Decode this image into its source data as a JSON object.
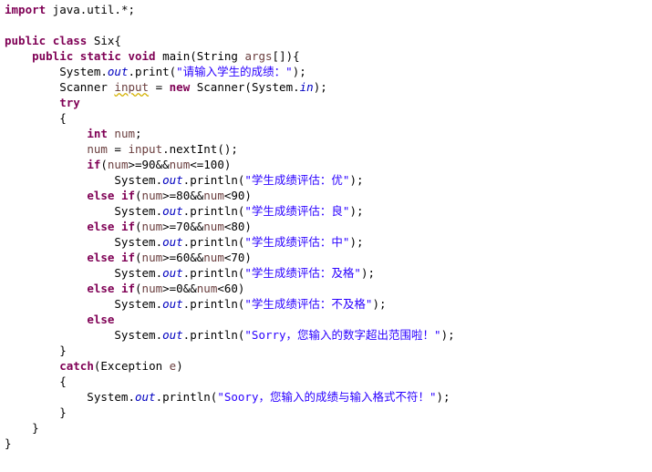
{
  "lines": [
    [
      {
        "t": "import",
        "c": "kw"
      },
      {
        "t": " java.util.*;"
      }
    ],
    [],
    [
      {
        "t": "public",
        "c": "kw"
      },
      {
        "t": " "
      },
      {
        "t": "class",
        "c": "kw"
      },
      {
        "t": " Six{"
      }
    ],
    [
      {
        "t": "    "
      },
      {
        "t": "public",
        "c": "kw"
      },
      {
        "t": " "
      },
      {
        "t": "static",
        "c": "kw"
      },
      {
        "t": " "
      },
      {
        "t": "void",
        "c": "kw"
      },
      {
        "t": " main(String "
      },
      {
        "t": "args",
        "c": "lv"
      },
      {
        "t": "[]){"
      }
    ],
    [
      {
        "t": "        System."
      },
      {
        "t": "out",
        "c": "fld"
      },
      {
        "t": ".print("
      },
      {
        "t": "\"请输入学生的成绩：\"",
        "c": "str"
      },
      {
        "t": ");"
      }
    ],
    [
      {
        "t": "        Scanner "
      },
      {
        "t": "input",
        "c": "lv warn"
      },
      {
        "t": " = "
      },
      {
        "t": "new",
        "c": "kw"
      },
      {
        "t": " Scanner(System."
      },
      {
        "t": "in",
        "c": "fld"
      },
      {
        "t": ");"
      }
    ],
    [
      {
        "t": "        "
      },
      {
        "t": "try",
        "c": "kw"
      }
    ],
    [
      {
        "t": "        {"
      }
    ],
    [
      {
        "t": "            "
      },
      {
        "t": "int",
        "c": "kw"
      },
      {
        "t": " "
      },
      {
        "t": "num",
        "c": "lv"
      },
      {
        "t": ";"
      }
    ],
    [
      {
        "t": "            "
      },
      {
        "t": "num",
        "c": "lv"
      },
      {
        "t": " = "
      },
      {
        "t": "input",
        "c": "lv"
      },
      {
        "t": ".nextInt();"
      }
    ],
    [
      {
        "t": "            "
      },
      {
        "t": "if",
        "c": "kw"
      },
      {
        "t": "("
      },
      {
        "t": "num",
        "c": "lv"
      },
      {
        "t": ">=90&&"
      },
      {
        "t": "num",
        "c": "lv"
      },
      {
        "t": "<=100)"
      }
    ],
    [
      {
        "t": "                System."
      },
      {
        "t": "out",
        "c": "fld"
      },
      {
        "t": ".println("
      },
      {
        "t": "\"学生成绩评估：优\"",
        "c": "str"
      },
      {
        "t": ");"
      }
    ],
    [
      {
        "t": "            "
      },
      {
        "t": "else",
        "c": "kw"
      },
      {
        "t": " "
      },
      {
        "t": "if",
        "c": "kw"
      },
      {
        "t": "("
      },
      {
        "t": "num",
        "c": "lv"
      },
      {
        "t": ">=80&&"
      },
      {
        "t": "num",
        "c": "lv"
      },
      {
        "t": "<90)"
      }
    ],
    [
      {
        "t": "                System."
      },
      {
        "t": "out",
        "c": "fld"
      },
      {
        "t": ".println("
      },
      {
        "t": "\"学生成绩评估：良\"",
        "c": "str"
      },
      {
        "t": ");"
      }
    ],
    [
      {
        "t": "            "
      },
      {
        "t": "else",
        "c": "kw"
      },
      {
        "t": " "
      },
      {
        "t": "if",
        "c": "kw"
      },
      {
        "t": "("
      },
      {
        "t": "num",
        "c": "lv"
      },
      {
        "t": ">=70&&"
      },
      {
        "t": "num",
        "c": "lv"
      },
      {
        "t": "<80)"
      }
    ],
    [
      {
        "t": "                System."
      },
      {
        "t": "out",
        "c": "fld"
      },
      {
        "t": ".println("
      },
      {
        "t": "\"学生成绩评估：中\"",
        "c": "str"
      },
      {
        "t": ");"
      }
    ],
    [
      {
        "t": "            "
      },
      {
        "t": "else",
        "c": "kw"
      },
      {
        "t": " "
      },
      {
        "t": "if",
        "c": "kw"
      },
      {
        "t": "("
      },
      {
        "t": "num",
        "c": "lv"
      },
      {
        "t": ">=60&&"
      },
      {
        "t": "num",
        "c": "lv"
      },
      {
        "t": "<70)"
      }
    ],
    [
      {
        "t": "                System."
      },
      {
        "t": "out",
        "c": "fld"
      },
      {
        "t": ".println("
      },
      {
        "t": "\"学生成绩评估：及格\"",
        "c": "str"
      },
      {
        "t": ");"
      }
    ],
    [
      {
        "t": "            "
      },
      {
        "t": "else",
        "c": "kw"
      },
      {
        "t": " "
      },
      {
        "t": "if",
        "c": "kw"
      },
      {
        "t": "("
      },
      {
        "t": "num",
        "c": "lv"
      },
      {
        "t": ">=0&&"
      },
      {
        "t": "num",
        "c": "lv"
      },
      {
        "t": "<60)"
      }
    ],
    [
      {
        "t": "                System."
      },
      {
        "t": "out",
        "c": "fld"
      },
      {
        "t": ".println("
      },
      {
        "t": "\"学生成绩评估：不及格\"",
        "c": "str"
      },
      {
        "t": ");"
      }
    ],
    [
      {
        "t": "            "
      },
      {
        "t": "else",
        "c": "kw"
      }
    ],
    [
      {
        "t": "                System."
      },
      {
        "t": "out",
        "c": "fld"
      },
      {
        "t": ".println("
      },
      {
        "t": "\"Sorry，您输入的数字超出范围啦！\"",
        "c": "str"
      },
      {
        "t": ");"
      }
    ],
    [
      {
        "t": "        }"
      }
    ],
    [
      {
        "t": "        "
      },
      {
        "t": "catch",
        "c": "kw"
      },
      {
        "t": "(Exception "
      },
      {
        "t": "e",
        "c": "lv"
      },
      {
        "t": ")"
      }
    ],
    [
      {
        "t": "        {"
      }
    ],
    [
      {
        "t": "            System."
      },
      {
        "t": "out",
        "c": "fld"
      },
      {
        "t": ".println("
      },
      {
        "t": "\"Soory，您输入的成绩与输入格式不符！\"",
        "c": "str"
      },
      {
        "t": ");"
      }
    ],
    [
      {
        "t": "        }"
      }
    ],
    [
      {
        "t": "    }"
      }
    ],
    [
      {
        "t": "}"
      }
    ]
  ]
}
